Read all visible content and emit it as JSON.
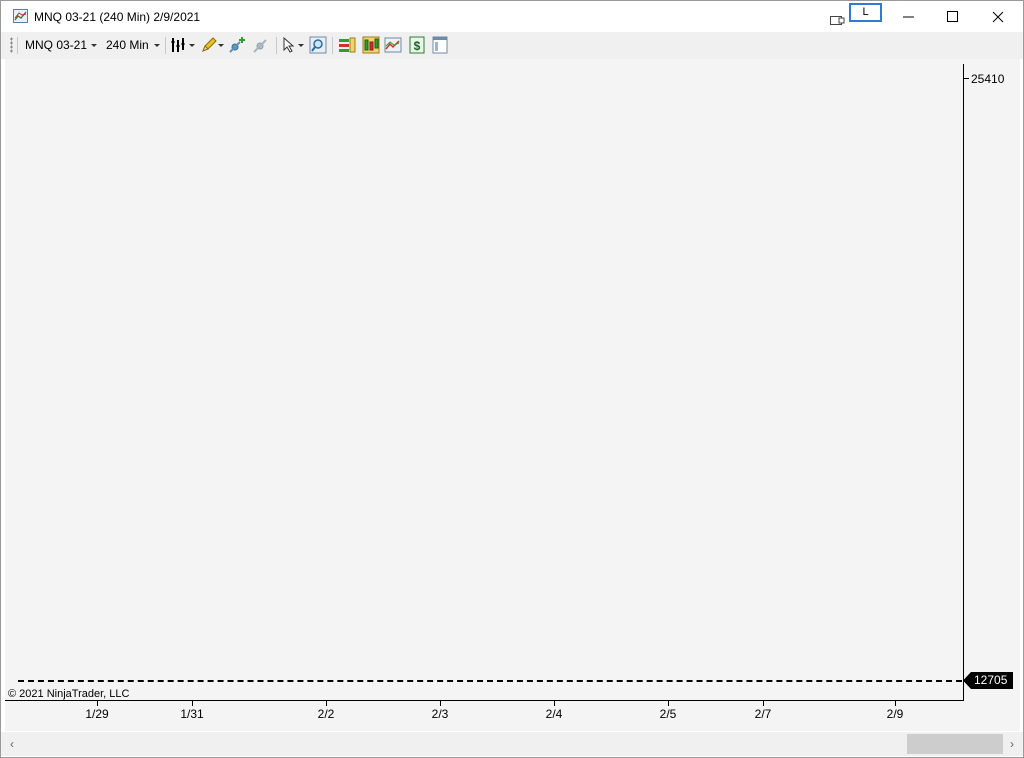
{
  "window": {
    "title": "MNQ 03-21 (240 Min)  2/9/2021",
    "link_button": "L",
    "minimize_glyph": "—",
    "maximize_glyph": "☐",
    "close_glyph": "✕"
  },
  "toolbar": {
    "instrument": "MNQ 03-21",
    "interval": "240 Min",
    "icons": [
      "bar-style-icon",
      "drawing-pencil-icon",
      "add-indicator-icon",
      "remove-indicator-icon",
      "cursor-select-icon",
      "zoom-icon",
      "strategies-icon",
      "indicators-icon",
      "chart-trader-icon",
      "dollar-icon",
      "properties-icon"
    ]
  },
  "chart": {
    "copyright": "© 2021 NinjaTrader, LLC",
    "y_top_label": "25410",
    "price_marker": "12705",
    "x_labels": [
      "1/29",
      "1/31",
      "2/2",
      "2/3",
      "2/4",
      "2/5",
      "2/7",
      "2/9"
    ]
  },
  "chart_data": {
    "type": "line",
    "title": "",
    "x": [
      "1/29",
      "1/31",
      "2/2",
      "2/3",
      "2/4",
      "2/5",
      "2/7",
      "2/9"
    ],
    "y_ticks": [
      25410
    ],
    "current_price": 12705,
    "series": []
  },
  "scrollbar": {
    "left_arrow": "‹",
    "right_arrow": "›"
  }
}
